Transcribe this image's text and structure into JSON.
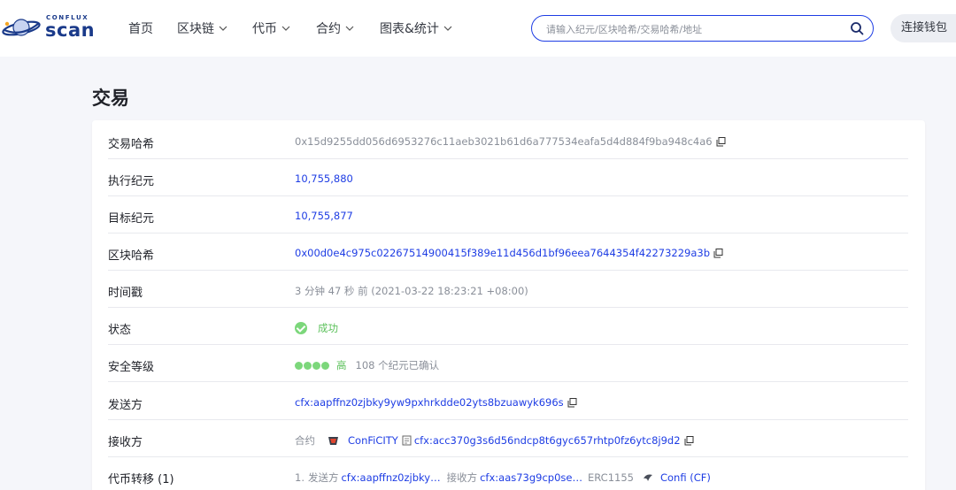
{
  "header": {
    "logo_small": "CONFLUX",
    "logo_big": "scan",
    "nav": [
      "首页",
      "区块链",
      "代币",
      "合约",
      "图表&统计"
    ],
    "search_placeholder": "请输入纪元/区块哈希/交易哈希/地址",
    "connect_wallet": "连接钱包"
  },
  "page_title": "交易",
  "details": {
    "tx_hash": {
      "label": "交易哈希",
      "value": "0x15d9255dd056d6953276c11aeb3021b61d6a777534eafa5d4d884f9ba948c4a6"
    },
    "exec_epoch": {
      "label": "执行纪元",
      "value": "10,755,880"
    },
    "target_epoch": {
      "label": "目标纪元",
      "value": "10,755,877"
    },
    "block_hash": {
      "label": "区块哈希",
      "value": "0x00d0e4c975c02267514900415f389e11d456d1bf96eea7644354f42273229a3b"
    },
    "timestamp": {
      "label": "时间戳",
      "value": "3 分钟 47 秒 前 (2021-03-22 18:23:21 +08:00)"
    },
    "status": {
      "label": "状态",
      "value": "成功"
    },
    "security": {
      "label": "安全等级",
      "level": "高",
      "confirm": "108 个纪元已确认"
    },
    "from": {
      "label": "发送方",
      "value": "cfx:aapffnz0zjbky9yw9pxhrkdde02yts8bzuawyk696s"
    },
    "to": {
      "label": "接收方",
      "prefix": "合约",
      "token_name": "ConFiCITY",
      "address": "cfx:acc370g3s6d56ndcp8t6gyc657rhtp0fz6ytc8j9d2"
    },
    "token_transfer": {
      "label": "代币转移 (1)",
      "index": "1.",
      "from_label": "发送方",
      "from": "cfx:aapffnz0zjbky…",
      "to_label": "接收方",
      "to": "cfx:aas73g9cp0se…",
      "standard": "ERC1155",
      "token": "Confi (CF)"
    }
  },
  "colors": {
    "accent": "#1e3de4",
    "success": "#7cd77b",
    "bg": "#f5f6fa"
  }
}
